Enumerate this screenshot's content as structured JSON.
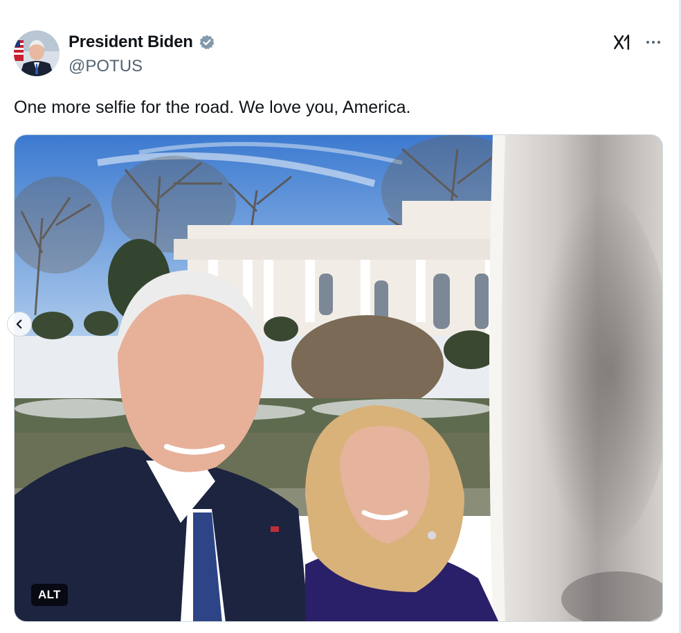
{
  "author": {
    "display_name": "President Biden",
    "handle": "@POTUS",
    "verified": true,
    "verified_color": "#1d9bf0"
  },
  "header_actions": {
    "grok_icon": "grok-icon",
    "more_icon": "more-icon"
  },
  "tweet": {
    "text": "One more selfie for the road. We love you, America."
  },
  "media": {
    "alt_label": "ALT",
    "carousel_prev_icon": "chevron-left-icon"
  },
  "colors": {
    "text": "#0f1419",
    "secondary": "#536471",
    "border": "#cfd9de"
  }
}
